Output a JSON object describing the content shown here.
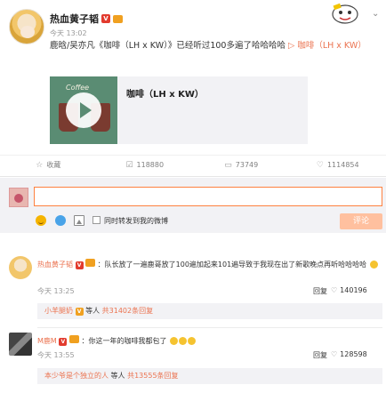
{
  "post": {
    "author": "热血黄子韬",
    "time": "今天 13:02",
    "text": "鹿晗/吴亦凡《咖啡（LH x KW）》已经听过100多遍了哈哈哈哈",
    "link": "▷ 咖啡（LH x KW）",
    "media_title": "咖啡（LH x KW）",
    "cover_text": "Coffee"
  },
  "actions": [
    {
      "icon": "☆",
      "label": "收藏"
    },
    {
      "icon": "☑",
      "label": "118880"
    },
    {
      "icon": "▭",
      "label": "73749"
    },
    {
      "icon": "♡",
      "label": "1114854"
    }
  ],
  "composer": {
    "placeholder": "",
    "repost_label": "同时转发到我的微博",
    "submit_label": "评论"
  },
  "comments": [
    {
      "name": "热血黄子韬",
      "text": "：队长放了一遍鹿哥放了100遍加起来101遍导致于我现在出了新歌晚点再听哈哈哈哈",
      "time": "今天 13:25",
      "reply": "回复",
      "likes": "140196",
      "sub": {
        "name": "小羊腿奶",
        "text": " 等人 ",
        "more": "共31402条回复"
      }
    },
    {
      "name": "M鹿M",
      "text": "：你这一年的咖啡我都包了",
      "time": "今天 13:55",
      "reply": "回复",
      "likes": "128598",
      "sub": {
        "name": "本少爷是个独立的人",
        "text": " 等人 ",
        "more": "共13555条回复"
      }
    }
  ],
  "colors": {
    "accent": "#eb7350",
    "input_border": "#ff8140",
    "submit_bg": "#ffc09f"
  }
}
